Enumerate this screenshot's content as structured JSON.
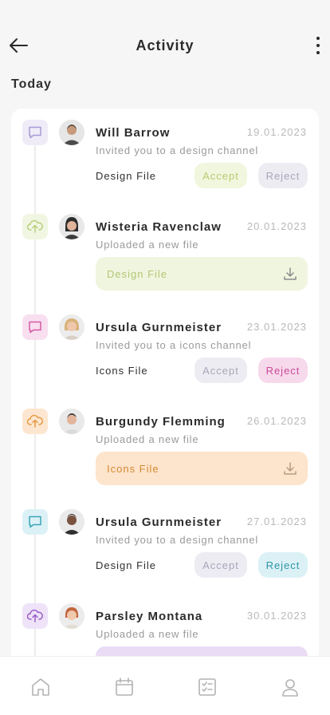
{
  "header": {
    "title": "Activity"
  },
  "section": {
    "label": "Today"
  },
  "items": [
    {
      "kind": "invite",
      "name": "Will Barrow",
      "date": "19.01.2023",
      "description": "Invited you to a design channel",
      "file_label": "Design File",
      "accept_label": "Accept",
      "reject_label": "Reject",
      "icon": "chat-icon",
      "icon_color": "#a99ad6",
      "icon_bg": "#efecf8",
      "accept_style": "active-green",
      "reject_style": "muted"
    },
    {
      "kind": "upload",
      "name": "Wisteria Ravenclaw",
      "date": "20.01.2023",
      "description": "Uploaded a new file",
      "file_label": "Design File",
      "icon": "cloud-upload-icon",
      "icon_color": "#b8cf7a",
      "icon_bg": "#f1f6e3"
    },
    {
      "kind": "invite",
      "name": "Ursula Gurnmeister",
      "date": "23.01.2023",
      "description": "Invited you to a icons channel",
      "file_label": "Icons File",
      "accept_label": "Accept",
      "reject_label": "Reject",
      "icon": "chat-icon",
      "icon_color": "#d45ba2",
      "icon_bg": "#f8dff0",
      "accept_style": "muted",
      "reject_style": "active-pink"
    },
    {
      "kind": "upload",
      "name": "Burgundy Flemming",
      "date": "26.01.2023",
      "description": "Uploaded a new file",
      "file_label": "Icons File",
      "icon": "cloud-upload-icon",
      "icon_color": "#e59a45",
      "icon_bg": "#fde6cf"
    },
    {
      "kind": "invite",
      "name": "Ursula Gurnmeister",
      "date": "27.01.2023",
      "description": "Invited you to a design channel",
      "file_label": "Design File",
      "accept_label": "Accept",
      "reject_label": "Reject",
      "icon": "chat-icon",
      "icon_color": "#3aa5b8",
      "icon_bg": "#dcf1f6",
      "accept_style": "muted",
      "reject_style": "active-cyan"
    },
    {
      "kind": "upload",
      "name": "Parsley Montana",
      "date": "30.01.2023",
      "description": "Uploaded a new file",
      "file_label": "",
      "icon": "cloud-upload-icon",
      "icon_color": "#9a5cc9",
      "icon_bg": "#eee3f8"
    }
  ],
  "nav": [
    {
      "icon": "home-icon"
    },
    {
      "icon": "calendar-icon"
    },
    {
      "icon": "tasks-icon"
    },
    {
      "icon": "profile-icon"
    }
  ],
  "colors": {
    "file_bar_green_bg": "#f0f5df",
    "file_bar_green_text": "#b3c774",
    "file_bar_orange_bg": "#fde4cc",
    "file_bar_orange_text": "#d58a33",
    "file_bar_purple_bg": "#eadcf5"
  }
}
